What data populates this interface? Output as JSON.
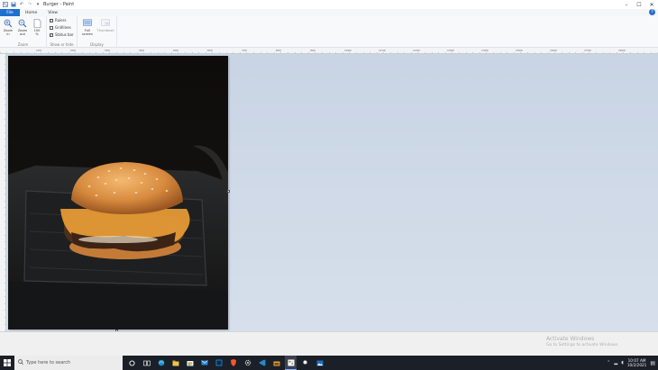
{
  "window": {
    "title": "Burger - Paint",
    "controls": [
      "minimize-icon",
      "maximize-icon",
      "close-icon"
    ]
  },
  "quick_access": [
    "save-icon",
    "undo-icon",
    "redo-icon",
    "customize-icon"
  ],
  "tabs": [
    {
      "label": "File",
      "active": true
    },
    {
      "label": "Home",
      "active": false
    },
    {
      "label": "View",
      "active": false
    }
  ],
  "ribbon": {
    "zoom": {
      "caption": "Zoom",
      "zoom_in": "Zoom\nin",
      "zoom_out": "Zoom\nout",
      "hundred": "100\n%"
    },
    "show_hide": {
      "caption": "Show or hide",
      "rulers": {
        "label": "Rulers",
        "checked": true
      },
      "gridlines": {
        "label": "Gridlines",
        "checked": false
      },
      "status_bar": {
        "label": "Status bar",
        "checked": true
      }
    },
    "display": {
      "caption": "Display",
      "full_screen": "Full\nscreen",
      "thumbnail": "Thumbnail"
    }
  },
  "ruler_labels": [
    "100",
    "200",
    "300",
    "400",
    "500",
    "600",
    "700",
    "800",
    "900",
    "1000",
    "1100",
    "1200",
    "1300",
    "1400",
    "1500",
    "1600",
    "1700",
    "1800"
  ],
  "watermark": {
    "line1": "Activate Windows",
    "line2": "Go to Settings to activate Windows."
  },
  "taskbar": {
    "search_placeholder": "Type here to search",
    "apps": [
      "cortana-icon",
      "task-view-icon",
      "edge-icon",
      "file-explorer-icon",
      "store-icon",
      "mail-icon",
      "photoshop-icon",
      "brave-icon",
      "settings-icon",
      "vscode-icon",
      "folder-icon",
      "paint-icon",
      "brightness-icon",
      "photos-icon"
    ],
    "time": "10:07 AM",
    "date": "10/2/2021"
  },
  "colors": {
    "accent": "#1e6fd0",
    "workspace": "#cdd7e6",
    "taskbar": "#1b1f27"
  }
}
